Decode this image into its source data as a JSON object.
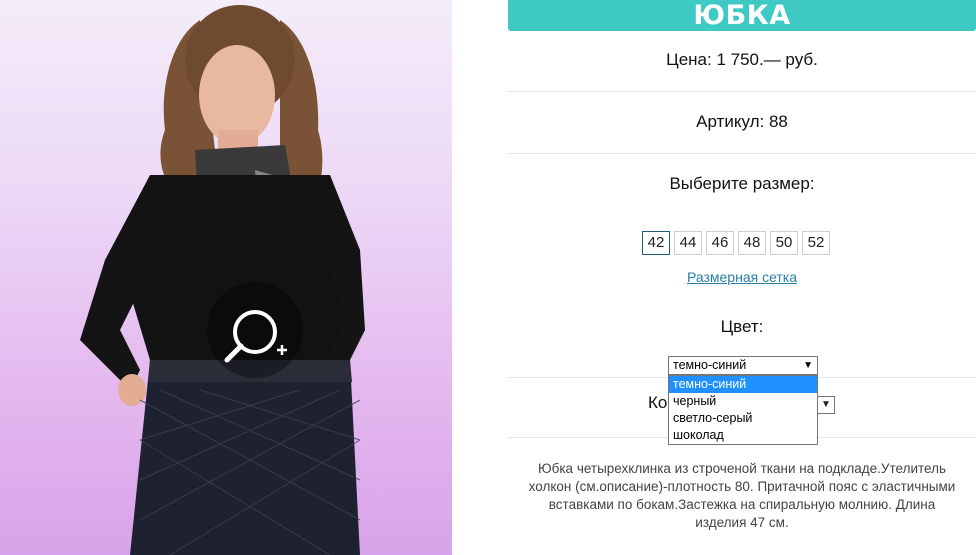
{
  "product": {
    "title": "ЮБКА",
    "price": "Цена: 1 750.— руб.",
    "sku": "Артикул: 88",
    "size_heading": "Выберите размер:",
    "sizes": [
      "42",
      "44",
      "46",
      "48",
      "50",
      "52"
    ],
    "selected_size": "42",
    "size_chart_link": "Размерная сетка",
    "color_heading": "Цвет:",
    "color_selected": "темно-синий",
    "color_options": [
      "темно-синий",
      "черный",
      "светло-серый",
      "шоколад"
    ],
    "quantity_label_partial": "Ко",
    "description": "Юбка четырехклинка из строченой ткани на подкладе.Утелитель холкон (см.описание)-плотность 80. Притачной пояс с эластичными вставками по бокам.Застежка на спиральную молнию. Длина изделия 47 см."
  },
  "colors": {
    "accent": "#3ec9c5",
    "link": "#2a7ea8",
    "dropdown_highlight": "#1e90ff",
    "active_size_border": "#1e5a7a"
  },
  "icons": {
    "zoom": "zoom-in-icon"
  }
}
